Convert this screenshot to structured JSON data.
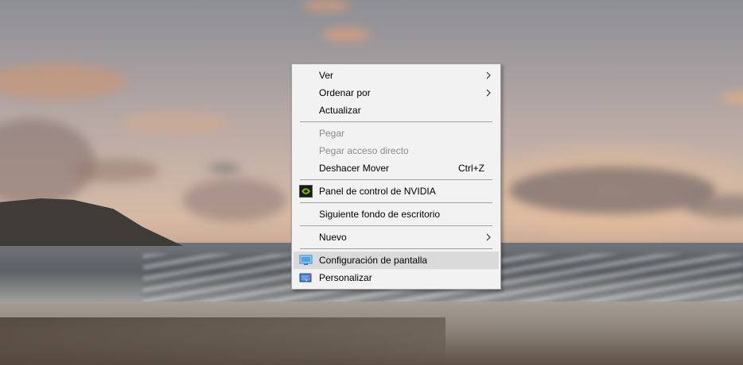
{
  "context_menu": {
    "items": {
      "ver": {
        "label": "Ver"
      },
      "ordenar": {
        "label": "Ordenar por"
      },
      "actualizar": {
        "label": "Actualizar"
      },
      "pegar": {
        "label": "Pegar",
        "disabled": true
      },
      "pegar_acceso": {
        "label": "Pegar acceso directo",
        "disabled": true
      },
      "deshacer": {
        "label": "Deshacer Mover",
        "shortcut": "Ctrl+Z"
      },
      "nvidia": {
        "label": "Panel de control de NVIDIA",
        "icon": "nvidia-icon"
      },
      "siguiente_fondo": {
        "label": "Siguiente fondo de escritorio"
      },
      "nuevo": {
        "label": "Nuevo"
      },
      "config_pantalla": {
        "label": "Configuración de pantalla",
        "icon": "display-settings-icon",
        "highlighted": true
      },
      "personalizar": {
        "label": "Personalizar",
        "icon": "personalize-icon"
      }
    }
  },
  "colors": {
    "menu_background": "#f2f2f2",
    "menu_border": "#a0a0a0",
    "highlight": "#dadada",
    "disabled_text": "#8c8c8c",
    "nvidia_green": "#76b900"
  }
}
